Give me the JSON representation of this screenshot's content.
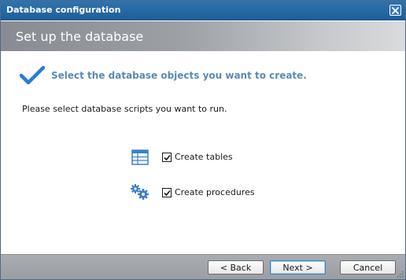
{
  "window": {
    "title": "Database configuration",
    "close_icon": "close-icon"
  },
  "header": {
    "title": "Set up the database"
  },
  "main": {
    "heading": "Select the database objects you want to create.",
    "instruction": "Please select database scripts you want to run.",
    "options": [
      {
        "label": "Create tables",
        "checked": true,
        "icon": "table-icon"
      },
      {
        "label": "Create procedures",
        "checked": true,
        "icon": "gears-icon"
      }
    ]
  },
  "footer": {
    "back_label": "< Back",
    "next_label": "Next >",
    "cancel_label": "Cancel"
  },
  "colors": {
    "titlebar": "#2f73ad",
    "heading": "#5a8ab5",
    "checkmark": "#2a7bd2"
  }
}
